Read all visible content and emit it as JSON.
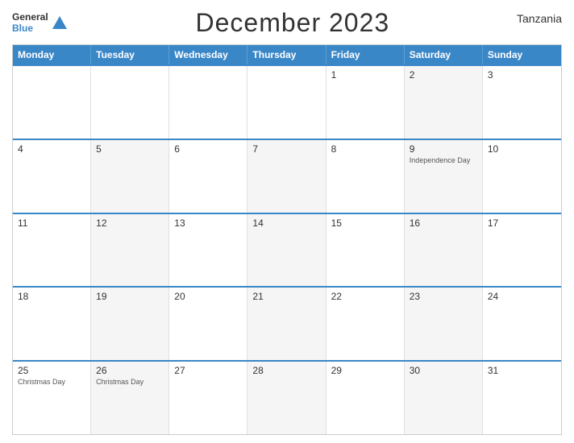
{
  "header": {
    "logo_general": "General",
    "logo_blue": "Blue",
    "month_title": "December 2023",
    "country": "Tanzania"
  },
  "weekdays": [
    "Monday",
    "Tuesday",
    "Wednesday",
    "Thursday",
    "Friday",
    "Saturday",
    "Sunday"
  ],
  "weeks": [
    [
      {
        "day": "",
        "holiday": "",
        "alt": false
      },
      {
        "day": "",
        "holiday": "",
        "alt": false
      },
      {
        "day": "",
        "holiday": "",
        "alt": false
      },
      {
        "day": "",
        "holiday": "",
        "alt": false
      },
      {
        "day": "1",
        "holiday": "",
        "alt": false
      },
      {
        "day": "2",
        "holiday": "",
        "alt": true
      },
      {
        "day": "3",
        "holiday": "",
        "alt": false
      }
    ],
    [
      {
        "day": "4",
        "holiday": "",
        "alt": false
      },
      {
        "day": "5",
        "holiday": "",
        "alt": true
      },
      {
        "day": "6",
        "holiday": "",
        "alt": false
      },
      {
        "day": "7",
        "holiday": "",
        "alt": true
      },
      {
        "day": "8",
        "holiday": "",
        "alt": false
      },
      {
        "day": "9",
        "holiday": "Independence Day",
        "alt": true
      },
      {
        "day": "10",
        "holiday": "",
        "alt": false
      }
    ],
    [
      {
        "day": "11",
        "holiday": "",
        "alt": false
      },
      {
        "day": "12",
        "holiday": "",
        "alt": true
      },
      {
        "day": "13",
        "holiday": "",
        "alt": false
      },
      {
        "day": "14",
        "holiday": "",
        "alt": true
      },
      {
        "day": "15",
        "holiday": "",
        "alt": false
      },
      {
        "day": "16",
        "holiday": "",
        "alt": true
      },
      {
        "day": "17",
        "holiday": "",
        "alt": false
      }
    ],
    [
      {
        "day": "18",
        "holiday": "",
        "alt": false
      },
      {
        "day": "19",
        "holiday": "",
        "alt": true
      },
      {
        "day": "20",
        "holiday": "",
        "alt": false
      },
      {
        "day": "21",
        "holiday": "",
        "alt": true
      },
      {
        "day": "22",
        "holiday": "",
        "alt": false
      },
      {
        "day": "23",
        "holiday": "",
        "alt": true
      },
      {
        "day": "24",
        "holiday": "",
        "alt": false
      }
    ],
    [
      {
        "day": "25",
        "holiday": "Christmas Day",
        "alt": false
      },
      {
        "day": "26",
        "holiday": "Christmas Day",
        "alt": true
      },
      {
        "day": "27",
        "holiday": "",
        "alt": false
      },
      {
        "day": "28",
        "holiday": "",
        "alt": true
      },
      {
        "day": "29",
        "holiday": "",
        "alt": false
      },
      {
        "day": "30",
        "holiday": "",
        "alt": true
      },
      {
        "day": "31",
        "holiday": "",
        "alt": false
      }
    ]
  ]
}
